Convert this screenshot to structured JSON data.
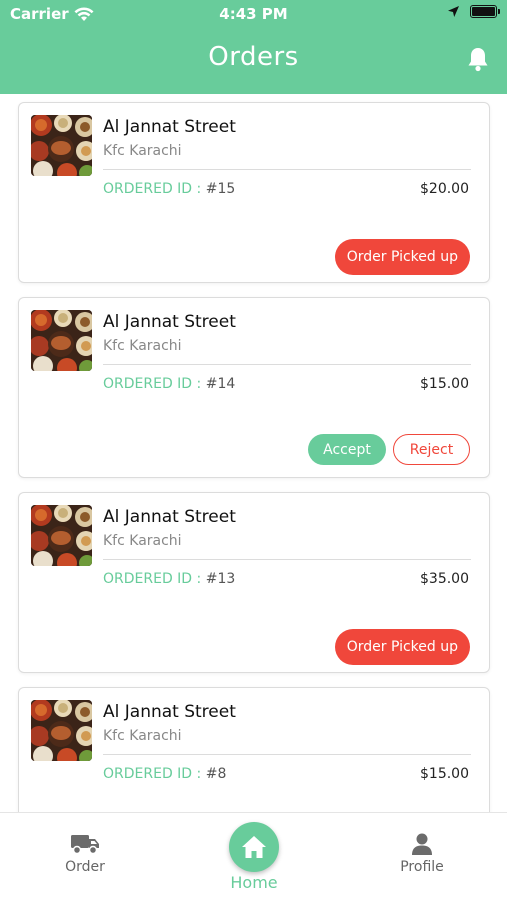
{
  "status_bar": {
    "carrier": "Carrier",
    "time": "4:43 PM"
  },
  "header": {
    "title": "Orders"
  },
  "orders": [
    {
      "street": "Al Jannat Street",
      "branch": "Kfc Karachi",
      "id_label": "ORDERED ID :",
      "id": "#15",
      "price": "$20.00",
      "action": "Order Picked up"
    },
    {
      "street": "Al Jannat Street",
      "branch": "Kfc Karachi",
      "id_label": "ORDERED ID :",
      "id": "#14",
      "price": "$15.00",
      "accept": "Accept",
      "reject": "Reject"
    },
    {
      "street": "Al Jannat Street",
      "branch": "Kfc Karachi",
      "id_label": "ORDERED ID :",
      "id": "#13",
      "price": "$35.00",
      "action": "Order Picked up"
    },
    {
      "street": "Al Jannat Street",
      "branch": "Kfc Karachi",
      "id_label": "ORDERED ID :",
      "id": "#8",
      "price": "$15.00"
    }
  ],
  "tabbar": {
    "order": "Order",
    "home": "Home",
    "profile": "Profile"
  },
  "colors": {
    "primary": "#68cc9b",
    "danger": "#f0473b",
    "border": "#dcdcdc"
  },
  "icons": [
    "wifi-icon",
    "location-arrow-icon",
    "battery-icon",
    "bell-icon",
    "truck-icon",
    "home-icon",
    "person-icon"
  ]
}
